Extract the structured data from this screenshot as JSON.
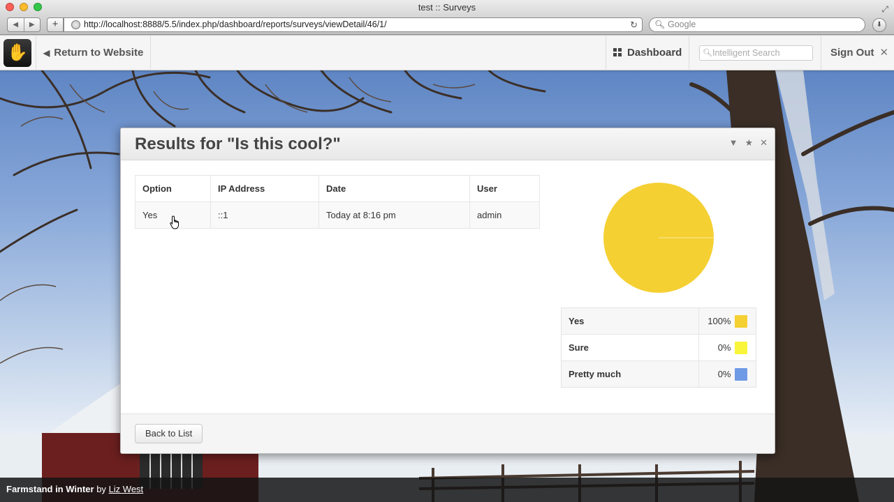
{
  "browser": {
    "title": "test :: Surveys",
    "url": "http://localhost:8888/5.5/index.php/dashboard/reports/surveys/viewDetail/46/1/",
    "search_placeholder": "Google"
  },
  "toolbar": {
    "return_label": "Return to Website",
    "dashboard_label": "Dashboard",
    "search_placeholder": "Intelligent Search",
    "signout_label": "Sign Out"
  },
  "dialog": {
    "title": "Results for \"Is this cool?\"",
    "table": {
      "headers": [
        "Option",
        "IP Address",
        "Date",
        "User"
      ],
      "rows": [
        [
          "Yes",
          "::1",
          "Today at 8:16 pm",
          "admin"
        ]
      ]
    },
    "legend": [
      {
        "name": "Yes",
        "percent": "100%",
        "color": "#f5d033"
      },
      {
        "name": "Sure",
        "percent": "0%",
        "color": "#f8f53b"
      },
      {
        "name": "Pretty much",
        "percent": "0%",
        "color": "#6f9ae6"
      }
    ],
    "back_label": "Back to List"
  },
  "chart_data": {
    "type": "pie",
    "categories": [
      "Yes",
      "Sure",
      "Pretty much"
    ],
    "values": [
      100,
      0,
      0
    ],
    "colors": [
      "#f5d033",
      "#f8f53b",
      "#6f9ae6"
    ]
  },
  "credit": {
    "title": "Farmstand in Winter",
    "by": "by",
    "author": "Liz West"
  }
}
